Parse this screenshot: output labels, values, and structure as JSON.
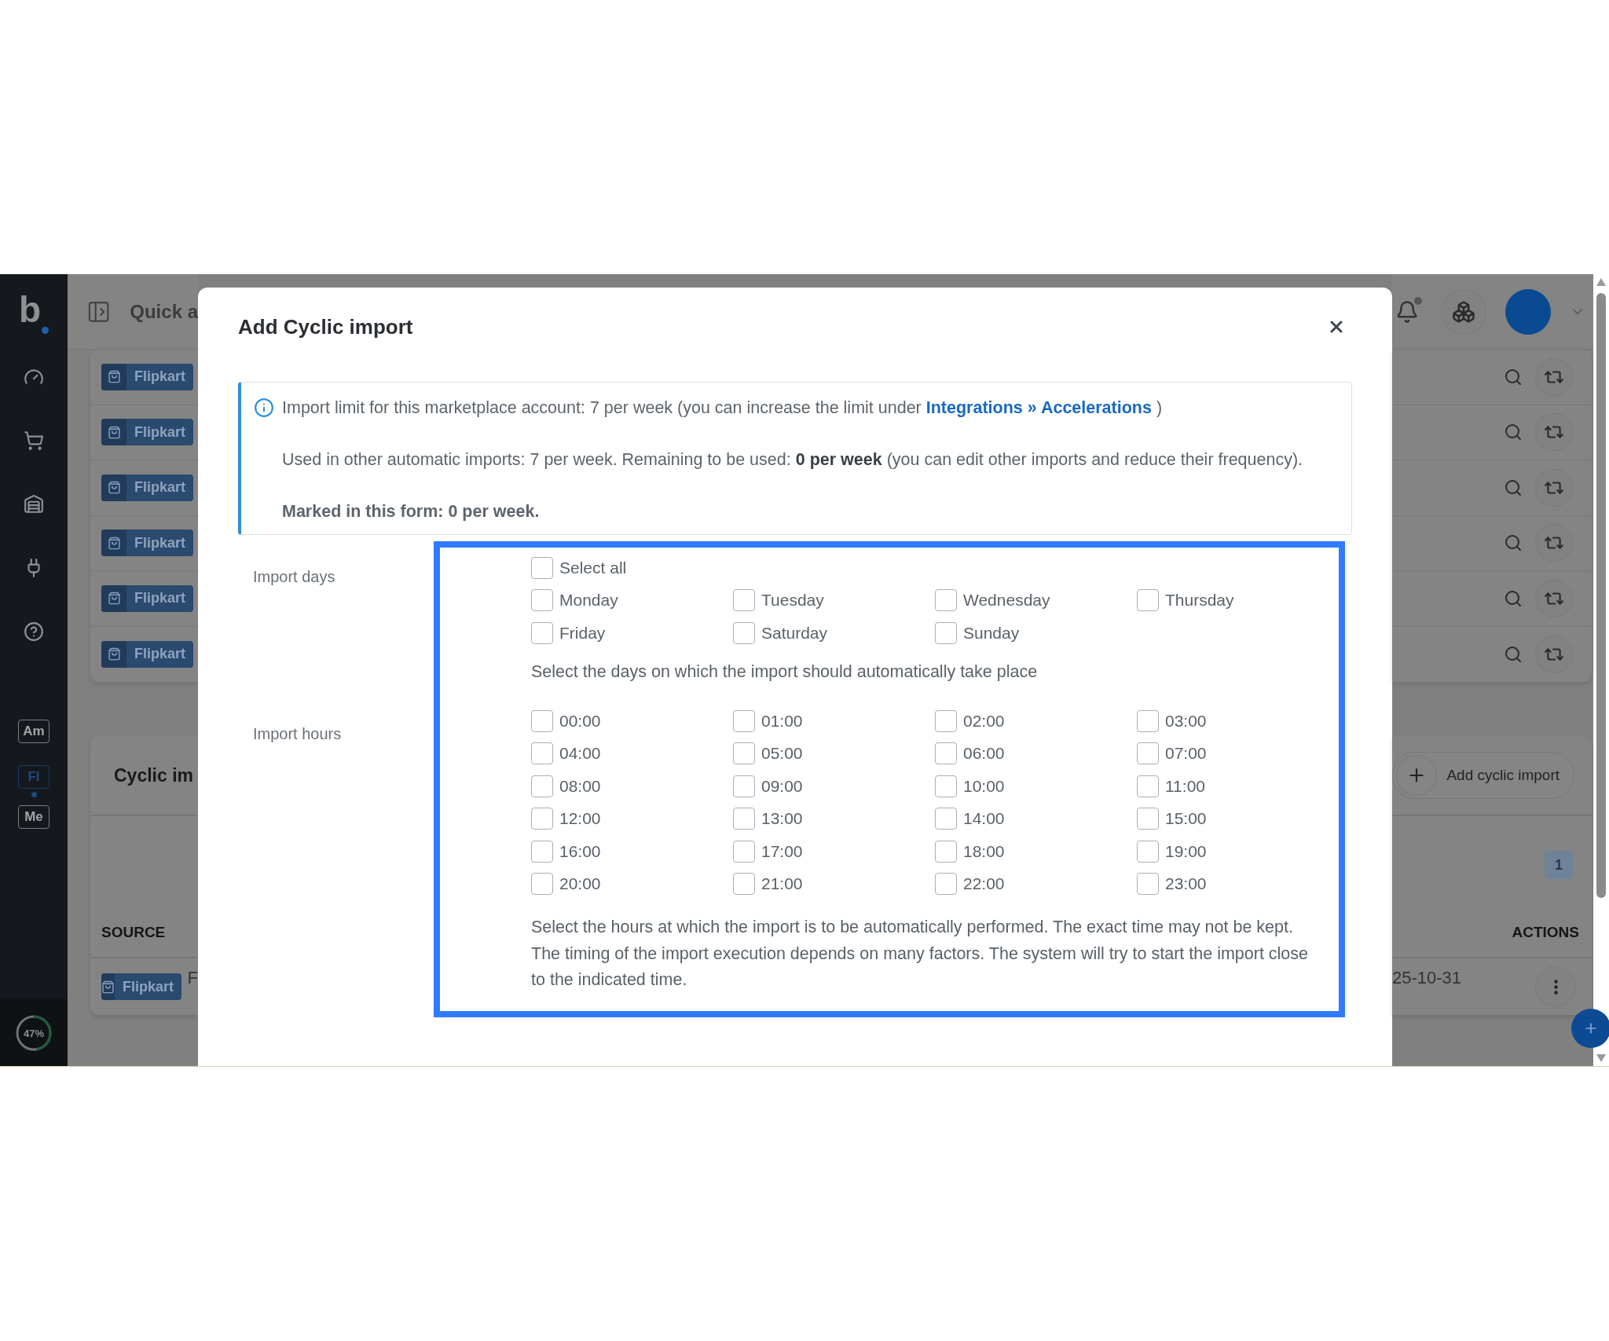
{
  "sidebar": {
    "logo": "b",
    "accounts": [
      {
        "label": "Am",
        "selected": false
      },
      {
        "label": "Fl",
        "selected": true
      },
      {
        "label": "Me",
        "selected": false
      }
    ],
    "usage": {
      "label": "47%",
      "level": 0.47
    }
  },
  "header": {
    "quick_label": "Quick a"
  },
  "marketplace_rows": [
    {
      "badge": "Flipkart"
    },
    {
      "badge": "Flipkart"
    },
    {
      "badge": "Flipkart"
    },
    {
      "badge": "Flipkart"
    },
    {
      "badge": "Flipkart"
    },
    {
      "badge": "Flipkart"
    }
  ],
  "cyclic_card": {
    "title": "Cyclic im",
    "add_button": "Add cyclic import",
    "page": "1",
    "columns": [
      "SOURCE",
      "ACTIONS"
    ],
    "row": {
      "badge": "Flipkart",
      "column_2": "F",
      "date": "25-10-31"
    }
  },
  "modal": {
    "title": "Add Cyclic import",
    "info": {
      "limit_text": "Import limit for this marketplace account: 7 per week (you can increase the limit under",
      "limit_link": "Integrations » Accelerations",
      "limit_suffix": ")",
      "used_text": "Used in other automatic imports: 7 per week. Remaining to be used: **0 per week** (you can edit other imports and reduce their frequency).",
      "marked_text": "Marked in this form: 0 per week."
    },
    "days": {
      "label": "Import days",
      "select_all": {
        "label": "Select all",
        "checked": false
      },
      "options": [
        {
          "label": "Monday",
          "checked": false
        },
        {
          "label": "Tuesday",
          "checked": false
        },
        {
          "label": "Wednesday",
          "checked": false
        },
        {
          "label": "Thursday",
          "checked": false
        },
        {
          "label": "Friday",
          "checked": false
        },
        {
          "label": "Saturday",
          "checked": false
        },
        {
          "label": "Sunday",
          "checked": false
        }
      ],
      "help": "Select the days on which the import should automatically take place"
    },
    "hours": {
      "label": "Import hours",
      "options": [
        {
          "label": "00:00",
          "checked": false
        },
        {
          "label": "01:00",
          "checked": false
        },
        {
          "label": "02:00",
          "checked": false
        },
        {
          "label": "03:00",
          "checked": false
        },
        {
          "label": "04:00",
          "checked": false
        },
        {
          "label": "05:00",
          "checked": false
        },
        {
          "label": "06:00",
          "checked": false
        },
        {
          "label": "07:00",
          "checked": false
        },
        {
          "label": "08:00",
          "checked": false
        },
        {
          "label": "09:00",
          "checked": false
        },
        {
          "label": "10:00",
          "checked": false
        },
        {
          "label": "11:00",
          "checked": false
        },
        {
          "label": "12:00",
          "checked": false
        },
        {
          "label": "13:00",
          "checked": false
        },
        {
          "label": "14:00",
          "checked": false
        },
        {
          "label": "15:00",
          "checked": false
        },
        {
          "label": "16:00",
          "checked": false
        },
        {
          "label": "17:00",
          "checked": false
        },
        {
          "label": "18:00",
          "checked": false
        },
        {
          "label": "19:00",
          "checked": false
        },
        {
          "label": "20:00",
          "checked": false
        },
        {
          "label": "21:00",
          "checked": false
        },
        {
          "label": "22:00",
          "checked": false
        },
        {
          "label": "23:00",
          "checked": false
        }
      ],
      "help": "Select the hours at which the import is to be automatically performed. The exact time may not be kept. The timing of the import execution depends on many factors. The system will try to start the import close to the indicated time."
    }
  }
}
